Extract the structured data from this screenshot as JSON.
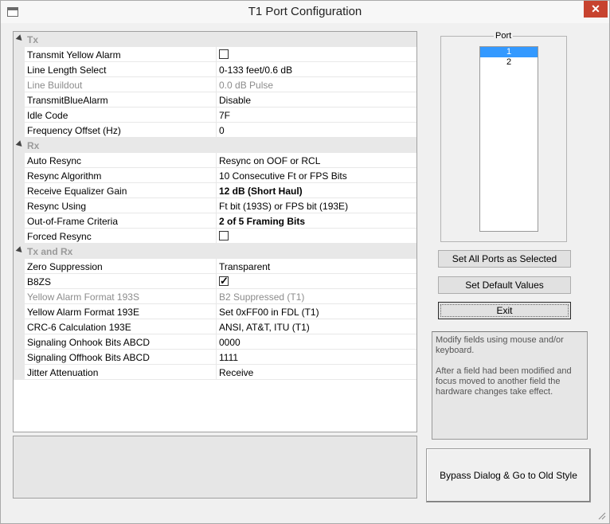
{
  "window": {
    "title": "T1 Port Configuration",
    "close_glyph": "✕"
  },
  "grid": {
    "tx": {
      "label": "Tx",
      "transmit_yellow_alarm": {
        "name": "Transmit Yellow Alarm",
        "checked": false
      },
      "line_length_select": {
        "name": "Line Length Select",
        "value": "0-133 feet/0.6 dB"
      },
      "line_buildout": {
        "name": "Line Buildout",
        "value": "0.0 dB Pulse"
      },
      "transmit_blue_alarm": {
        "name": "TransmitBlueAlarm",
        "value": "Disable"
      },
      "idle_code": {
        "name": "Idle Code",
        "value": "7F"
      },
      "frequency_offset": {
        "name": "Frequency Offset (Hz)",
        "value": "0"
      }
    },
    "rx": {
      "label": "Rx",
      "auto_resync": {
        "name": "Auto Resync",
        "value": "Resync on OOF or RCL"
      },
      "resync_algorithm": {
        "name": "Resync Algorithm",
        "value": "10 Consecutive Ft or FPS Bits"
      },
      "receive_equalizer_gain": {
        "name": "Receive Equalizer Gain",
        "value": "12 dB (Short Haul)"
      },
      "resync_using": {
        "name": "Resync Using",
        "value": "Ft bit (193S) or FPS bit (193E)"
      },
      "out_of_frame_criteria": {
        "name": "Out-of-Frame Criteria",
        "value": "2 of 5 Framing Bits"
      },
      "forced_resync": {
        "name": "Forced Resync",
        "checked": false
      }
    },
    "txrx": {
      "label": "Tx and Rx",
      "zero_suppression": {
        "name": "Zero Suppression",
        "value": "Transparent"
      },
      "b8zs": {
        "name": "B8ZS",
        "checked": true
      },
      "yellow_alarm_193s": {
        "name": "Yellow Alarm Format 193S",
        "value": "B2 Suppressed (T1)"
      },
      "yellow_alarm_193e": {
        "name": "Yellow Alarm Format 193E",
        "value": "Set 0xFF00 in FDL (T1)"
      },
      "crc6": {
        "name": "CRC-6 Calculation 193E",
        "value": "ANSI, AT&T, ITU (T1)"
      },
      "onhook_bits": {
        "name": "Signaling Onhook Bits ABCD",
        "value": "0000"
      },
      "offhook_bits": {
        "name": "Signaling Offhook Bits ABCD",
        "value": "1111"
      },
      "jitter_attenuation": {
        "name": "Jitter Attenuation",
        "value": "Receive"
      }
    }
  },
  "port": {
    "legend": "Port",
    "items": [
      "1",
      "2"
    ],
    "selected": "1"
  },
  "buttons": {
    "set_all": "Set All Ports as Selected",
    "set_default": "Set Default Values",
    "exit": "Exit",
    "bypass": "Bypass  Dialog & Go to Old Style"
  },
  "help": {
    "line1": "Modify fields using mouse and/or keyboard.",
    "line2": "After a field had been modified and focus moved to another field the hardware changes take effect."
  }
}
